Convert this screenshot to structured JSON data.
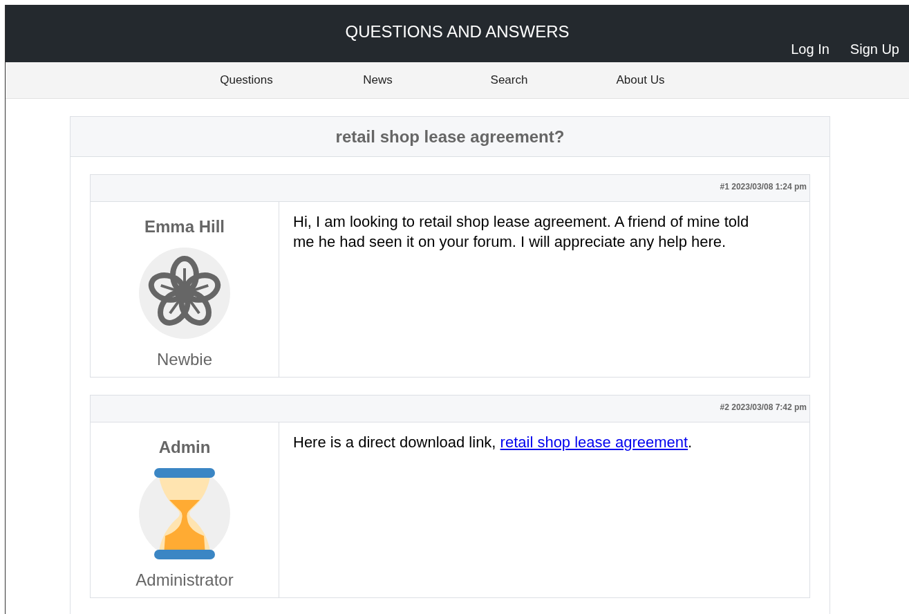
{
  "header": {
    "title": "QUESTIONS AND ANSWERS",
    "links": [
      "Log In",
      "Sign Up"
    ]
  },
  "nav": [
    "Questions",
    "News",
    "Search",
    "About Us"
  ],
  "thread": {
    "title": "retail shop lease agreement?",
    "posts": [
      {
        "meta": "#1 2023/03/08 1:24 pm",
        "author": "Emma Hill",
        "avatar": {
          "kind": "flower"
        },
        "rank": "Newbie",
        "message": {
          "text": "Hi, I am looking to retail shop lease agreement. A friend of mine told me he had seen it on your forum. I will appreciate any help here."
        }
      },
      {
        "meta": "#2 2023/03/08 7:42 pm",
        "author": "Admin",
        "avatar": {
          "kind": "hourglass"
        },
        "rank": "Administrator",
        "message": {
          "text": "Here is a direct download link, ",
          "link": "retail shop lease agreement",
          "after": "."
        }
      }
    ]
  }
}
